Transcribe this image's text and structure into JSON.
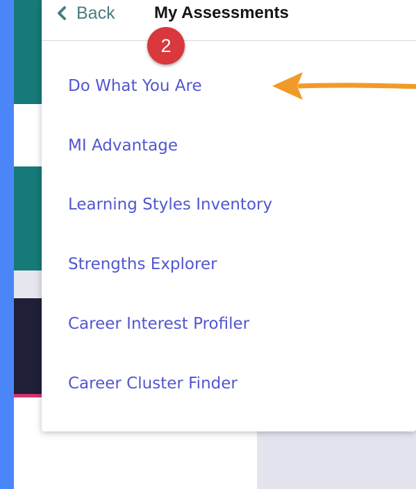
{
  "header": {
    "back_label": "Back",
    "title": "My Assessments"
  },
  "menu": {
    "items": [
      {
        "label": "Do What You Are"
      },
      {
        "label": "MI Advantage"
      },
      {
        "label": "Learning Styles Inventory"
      },
      {
        "label": "Strengths Explorer"
      },
      {
        "label": "Career Interest Profiler"
      },
      {
        "label": "Career Cluster Finder"
      }
    ]
  },
  "annotation": {
    "step_number": "2",
    "arrow_icon": "orange-arrow-left",
    "arrow_color": "#f29a27",
    "badge_color": "#d9383c"
  },
  "colors": {
    "frame": "#4a86f7",
    "link": "#5157cf",
    "back_link": "#4a7c82",
    "teal": "#167a78",
    "navy": "#1f1f38"
  }
}
